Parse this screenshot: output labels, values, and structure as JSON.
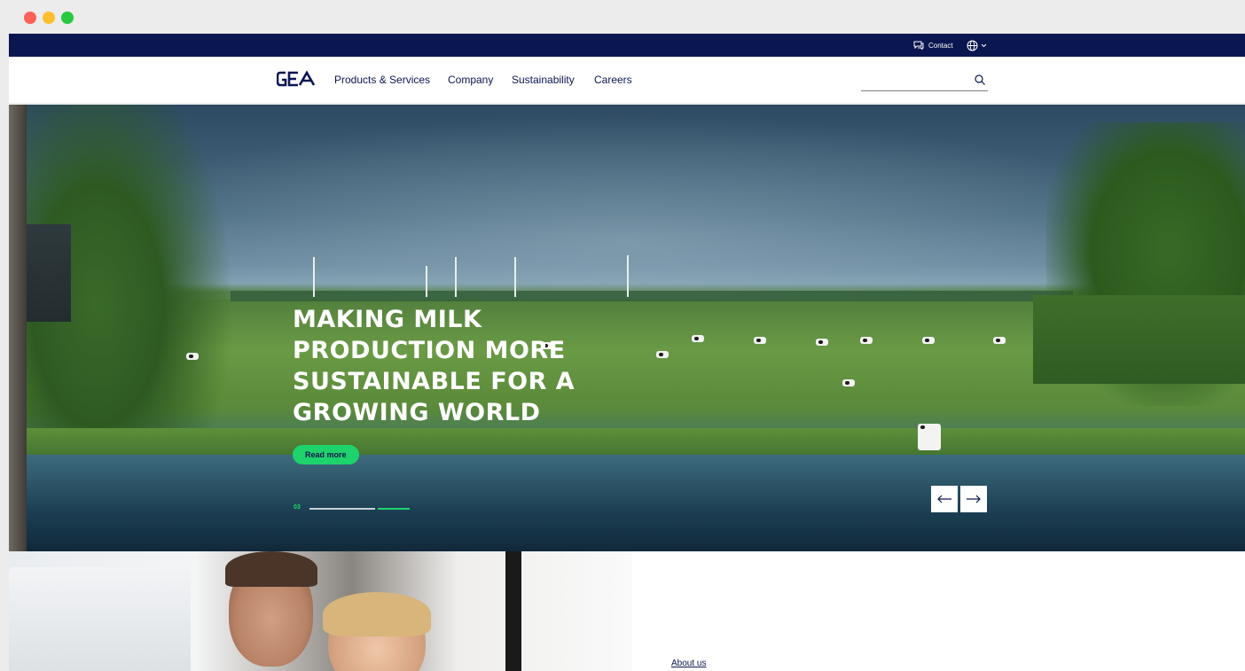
{
  "window": {
    "controls": [
      "close",
      "minimize",
      "maximize"
    ]
  },
  "topbar": {
    "contact_label": "Contact",
    "language_icon": "globe-icon"
  },
  "nav": {
    "logo_text": "GEA",
    "items": [
      {
        "label": "Products & Services"
      },
      {
        "label": "Company"
      },
      {
        "label": "Sustainability"
      },
      {
        "label": "Careers"
      }
    ],
    "search": {
      "value": "",
      "placeholder": ""
    }
  },
  "hero": {
    "headline_lines": [
      "MAKING MILK",
      "PRODUCTION MORE",
      "SUSTAINABLE FOR A",
      "GROWING WORLD"
    ],
    "cta_label": "Read more",
    "slide_number": "03",
    "slide_progress": 1.0
  },
  "lower": {
    "link_label": "About us"
  },
  "colors": {
    "navy": "#0a1650",
    "accent_green": "#1ed36c",
    "white": "#ffffff"
  }
}
